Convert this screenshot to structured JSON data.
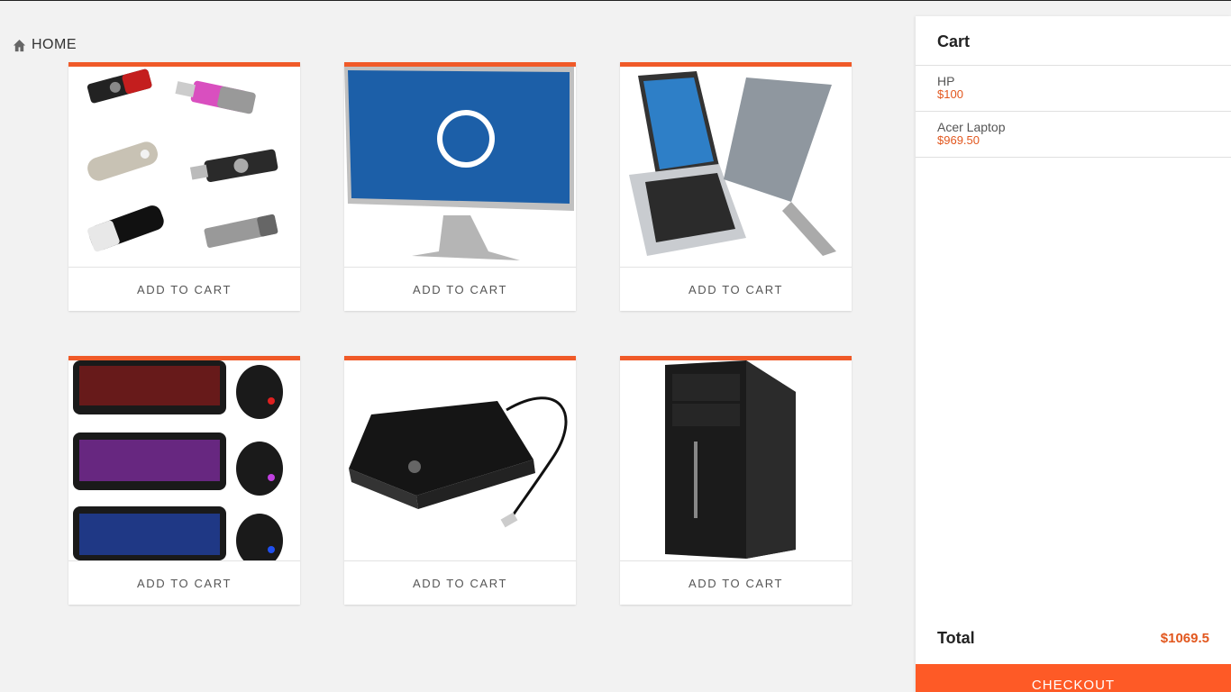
{
  "breadcrumb": {
    "home_label": "HOME",
    "icon": "home-icon"
  },
  "products": [
    {
      "image": "usb-flash-drives",
      "button_label": "ADD TO CART"
    },
    {
      "image": "hp-monitor",
      "button_label": "ADD TO CART"
    },
    {
      "image": "acer-laptops",
      "button_label": "ADD TO CART"
    },
    {
      "image": "gaming-keyboards-mice",
      "button_label": "ADD TO CART"
    },
    {
      "image": "external-hard-drive",
      "button_label": "ADD TO CART"
    },
    {
      "image": "acer-desktop-tower",
      "button_label": "ADD TO CART"
    }
  ],
  "cart": {
    "title": "Cart",
    "items": [
      {
        "name": "HP",
        "price": "$100"
      },
      {
        "name": "Acer Laptop",
        "price": "$969.50"
      }
    ],
    "total_label": "Total",
    "total_value": "$1069.5",
    "checkout_label": "CHECKOUT"
  },
  "colors": {
    "accent": "#f05a28",
    "price": "#e2571e",
    "checkout": "#fe5a26"
  }
}
